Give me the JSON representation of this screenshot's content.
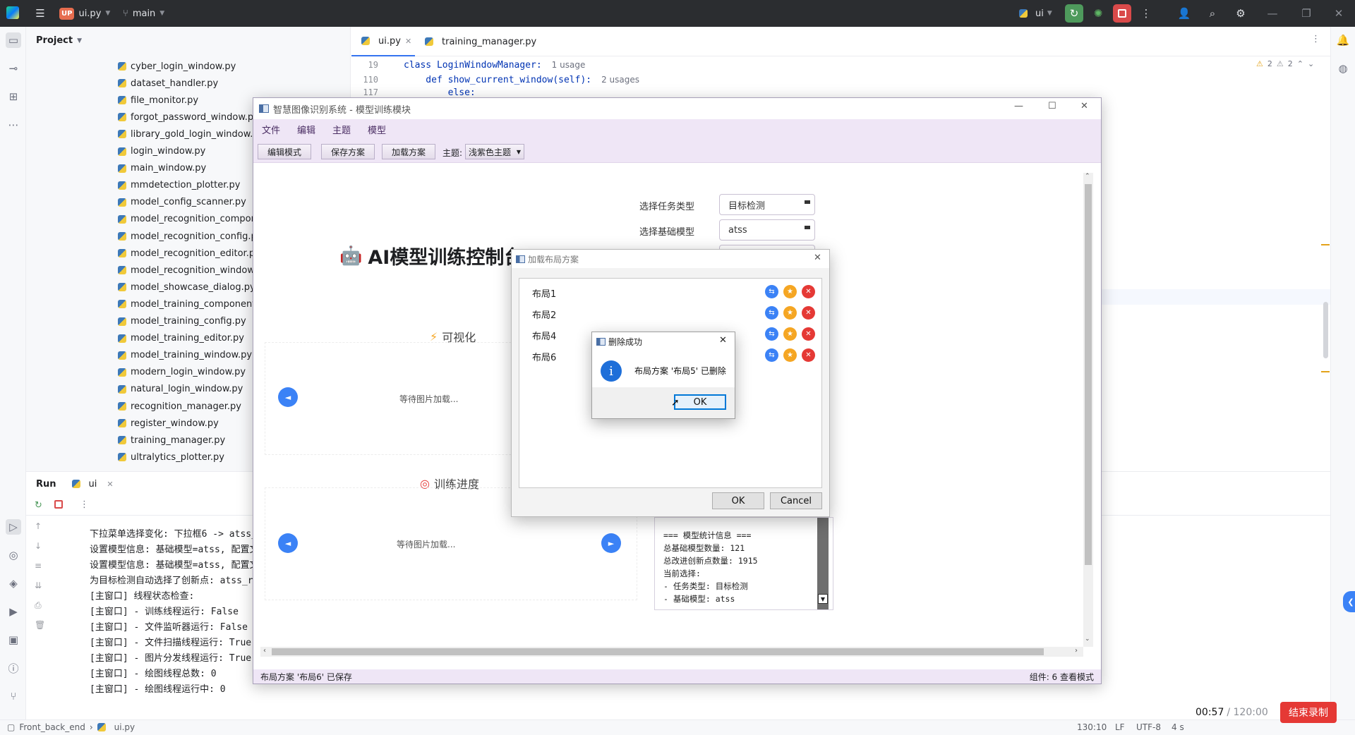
{
  "ide": {
    "project_badge": "UP",
    "file_name": "ui.py",
    "branch": "main",
    "run_config": "ui",
    "project_label": "Project",
    "tabs": [
      {
        "label": "ui.py"
      },
      {
        "label": "training_manager.py"
      }
    ],
    "code_lines": [
      {
        "num": "19",
        "code": "class LoginWindowManager:",
        "hint": "1 usage"
      },
      {
        "num": "110",
        "code": "    def show_current_window(self):",
        "hint": "2 usages"
      },
      {
        "num": "117",
        "code": "        else:",
        "hint": ""
      }
    ],
    "inspections": {
      "warn1": "2",
      "warn2": "2"
    },
    "files": [
      "cyber_login_window.py",
      "dataset_handler.py",
      "file_monitor.py",
      "forgot_password_window.py",
      "library_gold_login_window.py",
      "login_window.py",
      "main_window.py",
      "mmdetection_plotter.py",
      "model_config_scanner.py",
      "model_recognition_components.py",
      "model_recognition_config.py",
      "model_recognition_editor.py",
      "model_recognition_window.py",
      "model_showcase_dialog.py",
      "model_training_components.py",
      "model_training_config.py",
      "model_training_editor.py",
      "model_training_window.py",
      "modern_login_window.py",
      "natural_login_window.py",
      "recognition_manager.py",
      "register_window.py",
      "training_manager.py",
      "ultralytics_plotter.py"
    ],
    "run": {
      "title": "Run",
      "tab": "ui",
      "lines": [
        "下拉菜单选择变化: 下拉框6 -> atss_r101",
        "设置模型信息: 基础模型=atss, 配置文件路",
        "设置模型信息: 基础模型=atss, 配置文件路",
        "为目标检测自动选择了创新点: atss_r101_",
        "[主窗口] 线程状态检查:",
        "[主窗口] - 训练线程运行: False",
        "[主窗口] - 文件监听器运行: False",
        "[主窗口] - 文件扫描线程运行: True",
        "[主窗口] - 图片分发线程运行: True",
        "[主窗口] - 绘图线程总数: 0",
        "[主窗口] - 绘图线程运行中: 0"
      ]
    },
    "status": {
      "breadcrumb_project": "Front_back_end",
      "breadcrumb_file": "ui.py",
      "position": "130:10",
      "line_sep": "LF",
      "encoding": "UTF-8",
      "indent": "4 s"
    }
  },
  "recorder": {
    "time": "00:57",
    "total": "/ 120:00",
    "stop_label": "结束录制"
  },
  "app": {
    "title": "智慧图像识别系统 - 模型训练模块",
    "menu": [
      "文件",
      "编辑",
      "主题",
      "模型"
    ],
    "toolbar": {
      "edit_mode": "编辑模式",
      "save_layout": "保存方案",
      "load_layout": "加载方案",
      "theme_label": "主题:",
      "theme_value": "浅紫色主题"
    },
    "heading": "AI模型训练控制台",
    "task_type_label": "选择任务类型",
    "task_type_value": "目标检测",
    "base_model_label": "选择基础模型",
    "base_model_value": "atss",
    "visual_title": "可视化",
    "progress_title": "训练进度",
    "waiting_text": "等待图片加载...",
    "stats_lines": [
      "=== 模型统计信息 ===",
      "总基础模型数量: 121",
      "总改进创新点数量: 1915",
      "当前选择:",
      "- 任务类型: 目标检测",
      "- 基础模型: atss"
    ],
    "status_left": "布局方案 '布局6' 已保存",
    "status_right": "组件: 6  查看模式"
  },
  "layout_dialog": {
    "title": "加载布局方案",
    "items": [
      "布局1",
      "布局2",
      "布局4",
      "布局6"
    ],
    "ok": "OK",
    "cancel": "Cancel"
  },
  "message_box": {
    "title": "删除成功",
    "message": "布局方案 '布局5' 已删除",
    "ok": "OK"
  },
  "colors": {
    "accent_purple": "#efe6f6",
    "blue": "#3b82f6",
    "orange": "#f5a623",
    "red": "#e53935",
    "recorder_red": "#e53935"
  }
}
